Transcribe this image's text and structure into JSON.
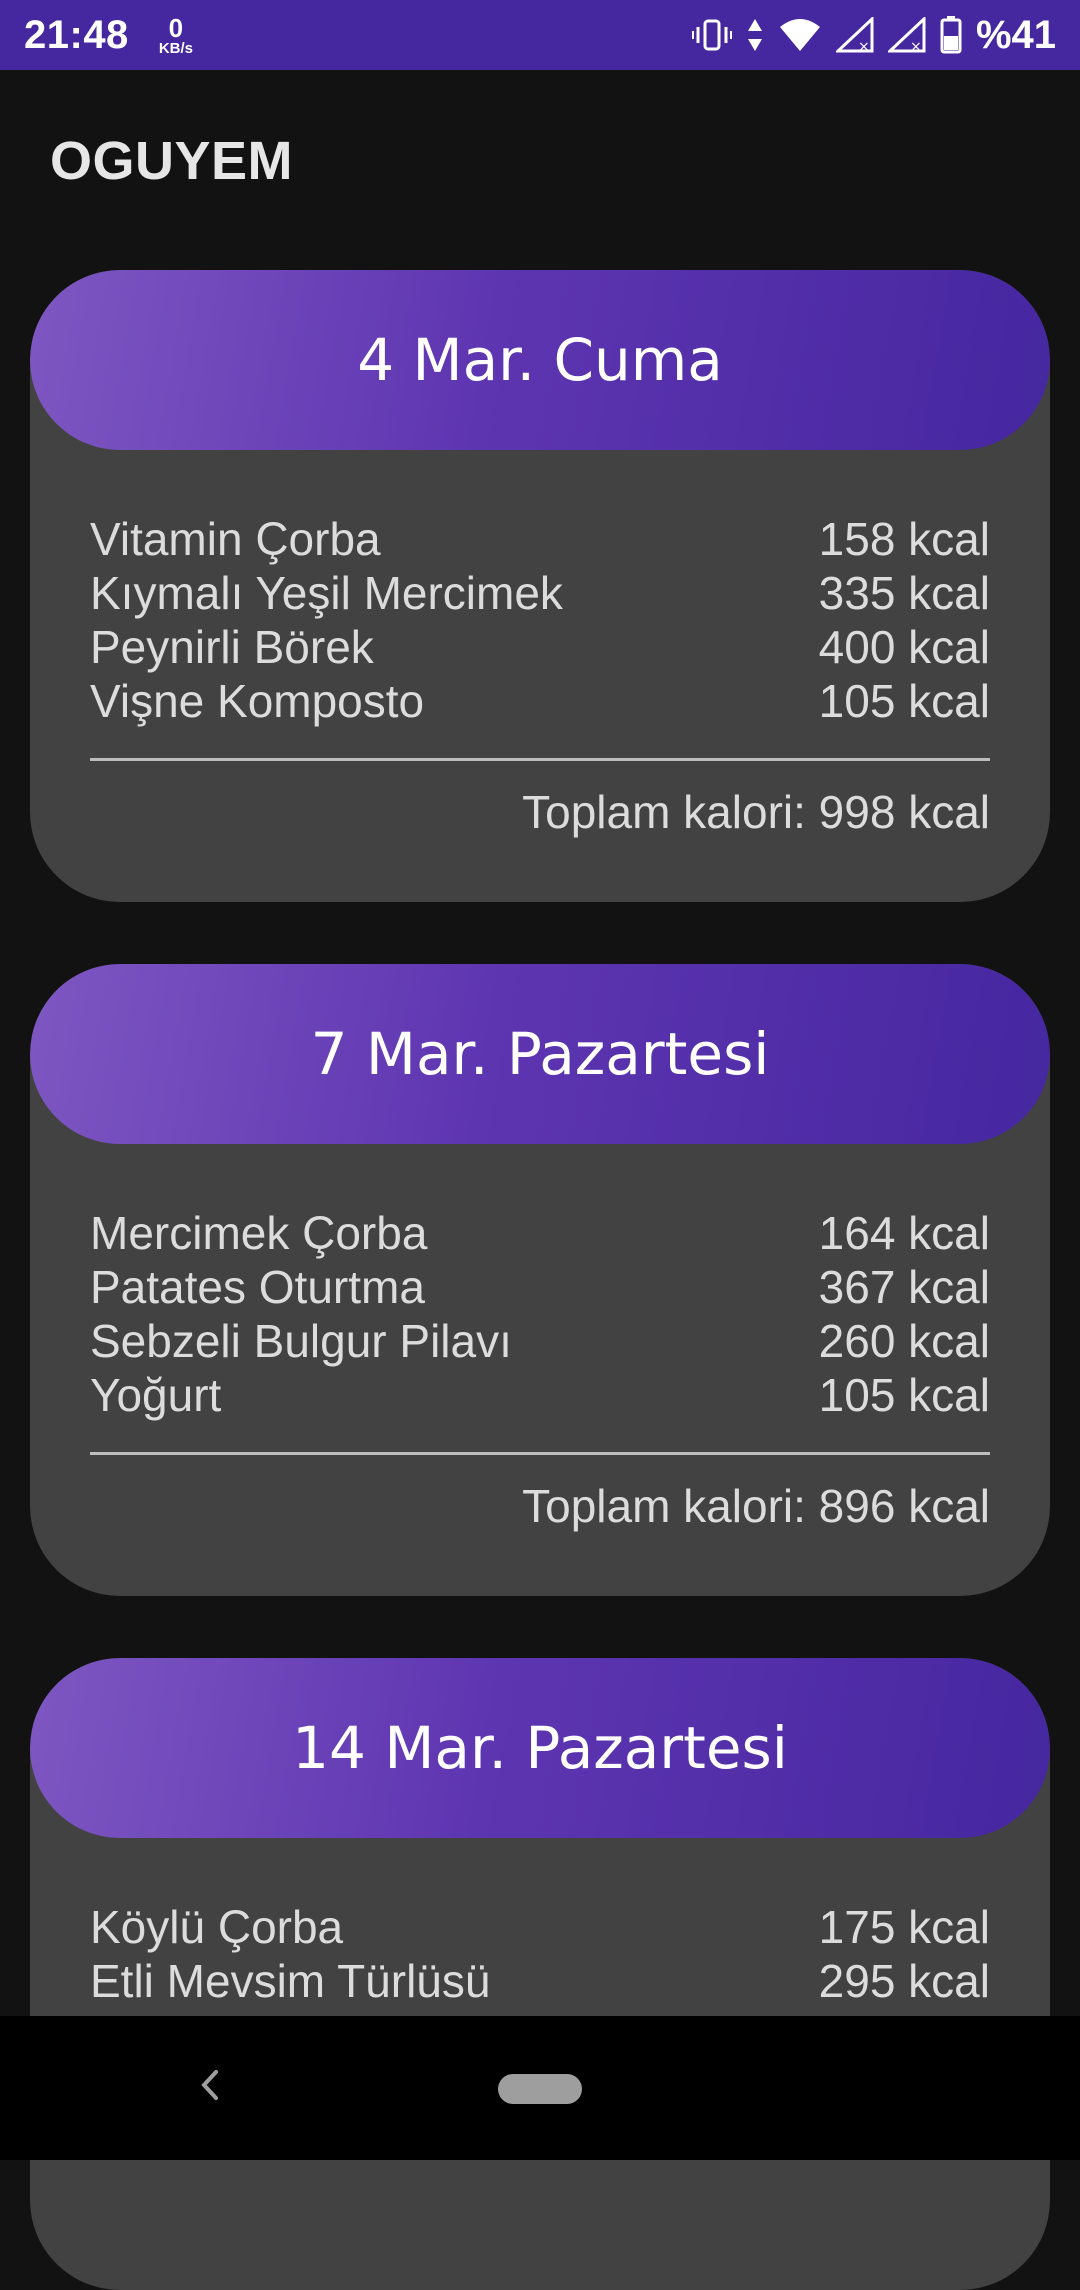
{
  "status": {
    "time": "21:48",
    "net_speed": "0",
    "net_unit": "KB/s",
    "battery": "%41",
    "icons": [
      "vibrate-icon",
      "data-arrows-icon",
      "wifi-icon",
      "signal-icon",
      "signal-icon",
      "battery-icon"
    ]
  },
  "app": {
    "title": "OGUYEM"
  },
  "colors": {
    "status_bar": "#4527a0",
    "header_start": "#7e57c2",
    "header_end": "#4527a0",
    "card": "#424242",
    "background": "#121212"
  },
  "days": [
    {
      "title": "4 Mar. Cuma",
      "items": [
        {
          "name": "Vitamin Çorba",
          "kcal": "158 kcal"
        },
        {
          "name": "Kıymalı Yeşil Mercimek",
          "kcal": "335 kcal"
        },
        {
          "name": "Peynirli Börek",
          "kcal": "400 kcal"
        },
        {
          "name": "Vişne Komposto",
          "kcal": "105 kcal"
        }
      ],
      "total": "Toplam kalori: 998 kcal"
    },
    {
      "title": "7 Mar. Pazartesi",
      "items": [
        {
          "name": "Mercimek Çorba",
          "kcal": "164 kcal"
        },
        {
          "name": "Patates Oturtma",
          "kcal": "367 kcal"
        },
        {
          "name": "Sebzeli Bulgur Pilavı",
          "kcal": "260 kcal"
        },
        {
          "name": "Yoğurt",
          "kcal": "105 kcal"
        }
      ],
      "total": "Toplam kalori: 896 kcal"
    },
    {
      "title": "14 Mar. Pazartesi",
      "items": [
        {
          "name": "Köylü Çorba",
          "kcal": "175 kcal"
        },
        {
          "name": "Etli Mevsim Türlüsü",
          "kcal": "295 kcal"
        }
      ],
      "total": ""
    }
  ]
}
